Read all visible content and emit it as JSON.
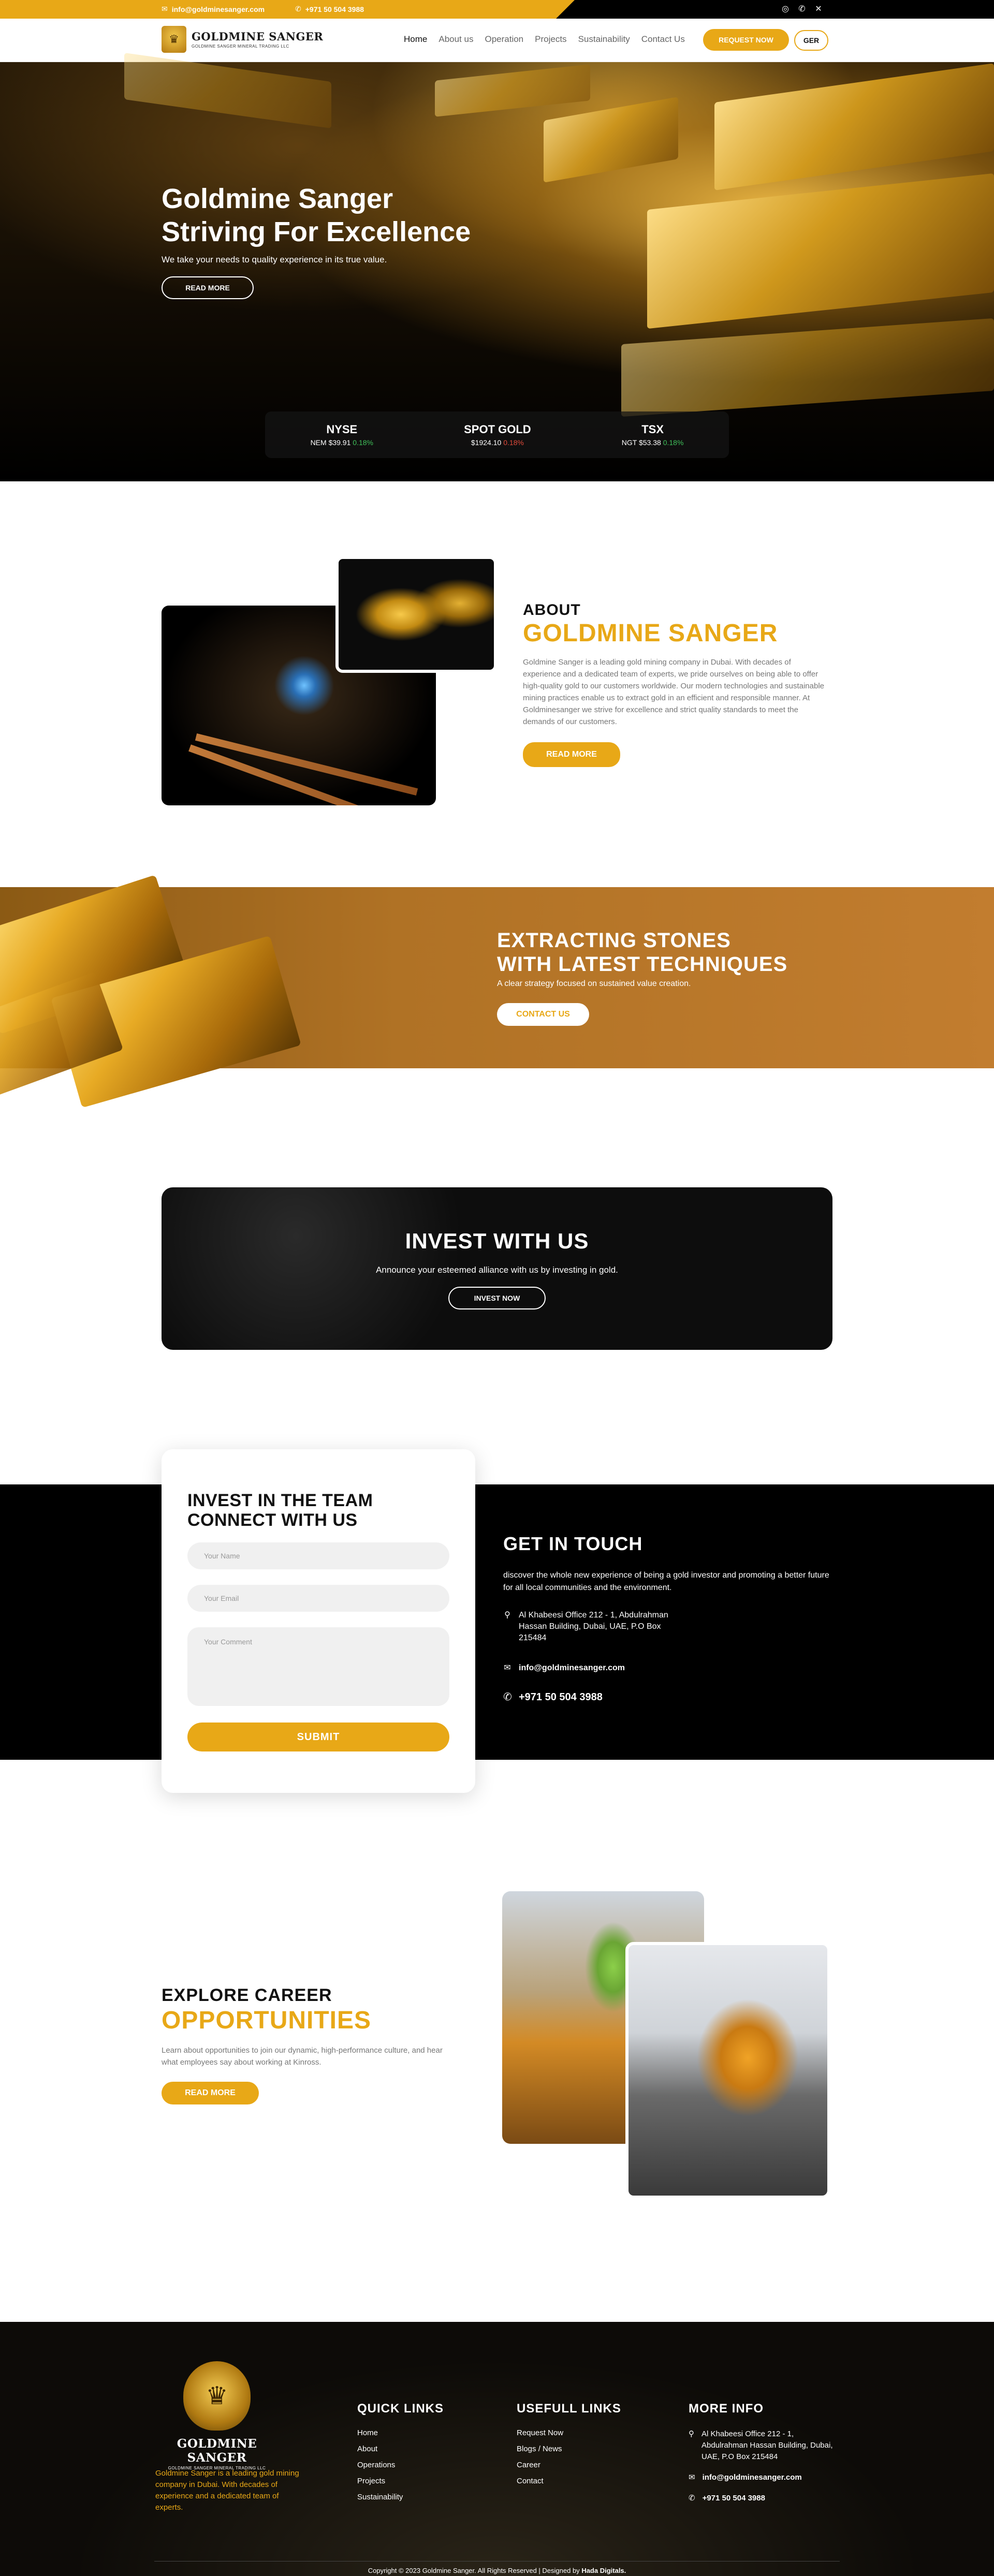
{
  "topbar": {
    "email": "info@goldminesanger.com",
    "phone": "+971 50 504 3988",
    "social": [
      "instagram-icon",
      "whatsapp-icon",
      "x-icon"
    ]
  },
  "header": {
    "logo_name": "GOLDMINE SANGER",
    "logo_sub": "GOLDMINE SANGER MINERAL TRADING LLC",
    "nav": [
      "Home",
      "About us",
      "Operation",
      "Projects",
      "Sustainability",
      "Contact Us"
    ],
    "request_label": "REQUEST NOW",
    "lang_label": "GER"
  },
  "hero": {
    "title_line1": "Goldmine Sanger",
    "title_line2": "Striving For Excellence",
    "subtitle": "We take your needs to quality experience in its true value.",
    "cta": "READ MORE",
    "tickers": [
      {
        "name": "NYSE",
        "value": "NEM $39.91",
        "change": "0.18%"
      },
      {
        "name": "SPOT GOLD",
        "value": "$1924.10",
        "change": "0.18%"
      },
      {
        "name": "TSX",
        "value": "NGT $53.38",
        "change": "0.18%"
      }
    ]
  },
  "about": {
    "eyebrow": "ABOUT",
    "title": "GOLDMINE SANGER",
    "body": "Goldmine Sanger is a leading gold mining company in Dubai. With decades of experience and a dedicated team of experts, we pride ourselves on being able to offer high-quality gold to our customers worldwide. Our modern technologies and sustainable mining practices enable us to extract gold in an efficient and responsible manner. At Goldminesanger we strive for excellence and strict quality standards to meet the demands of our customers.",
    "cta": "READ MORE"
  },
  "extract": {
    "title_line1": "EXTRACTING STONES",
    "title_line2": "WITH LATEST TECHNIQUES",
    "subtitle": "A clear strategy focused on sustained value creation.",
    "cta": "CONTACT US"
  },
  "invest": {
    "title": "INVEST WITH US",
    "subtitle": "Announce your esteemed alliance with us by investing in gold.",
    "cta": "INVEST NOW"
  },
  "form": {
    "title_line1": "INVEST IN THE TEAM",
    "title_line2": "CONNECT WITH US",
    "name_placeholder": "Your Name",
    "email_placeholder": "Your Email",
    "comment_placeholder": "Your Comment",
    "submit": "SUBMIT"
  },
  "contact": {
    "title": "GET IN TOUCH",
    "body": "discover the whole new experience of being a gold investor and promoting a better future for all local communities and the environment.",
    "address": "Al Khabeesi Office 212 - 1, Abdulrahman Hassan Building, Dubai, UAE, P.O Box 215484",
    "email": "info@goldminesanger.com",
    "phone": "+971 50 504 3988"
  },
  "career": {
    "eyebrow": "EXPLORE CAREER",
    "title": "OPPORTUNITIES",
    "body": "Learn about opportunities to join our dynamic, high-performance culture, and hear what employees say about working at Kinross.",
    "cta": "READ MORE"
  },
  "footer": {
    "logo_name": "GOLDMINE SANGER",
    "logo_sub": "GOLDMINE SANGER MINERAL TRADING LLC",
    "description": "Goldmine Sanger is a leading gold mining company in Dubai. With decades of experience and a dedicated team of experts.",
    "quick_title": "QUICK LINKS",
    "quick_links": [
      "Home",
      "About",
      "Operations",
      "Projects",
      "Sustainability"
    ],
    "useful_title": "USEFULL LINKS",
    "useful_links": [
      "Request Now",
      "Blogs / News",
      "Career",
      "Contact"
    ],
    "info_title": "MORE INFO",
    "info_address": "Al Khabeesi Office 212 - 1, Abdulrahman Hassan Building, Dubai, UAE, P.O Box 215484",
    "info_email": "info@goldminesanger.com",
    "info_phone": "+971 50 504 3988",
    "copyright": "Copyright © 2023 Goldmine Sanger. All Rights Reserved | Designed by",
    "designer": "Hada Digitals."
  },
  "colors": {
    "accent": "#e8a817",
    "dark": "#000000",
    "band": "#b07225"
  }
}
